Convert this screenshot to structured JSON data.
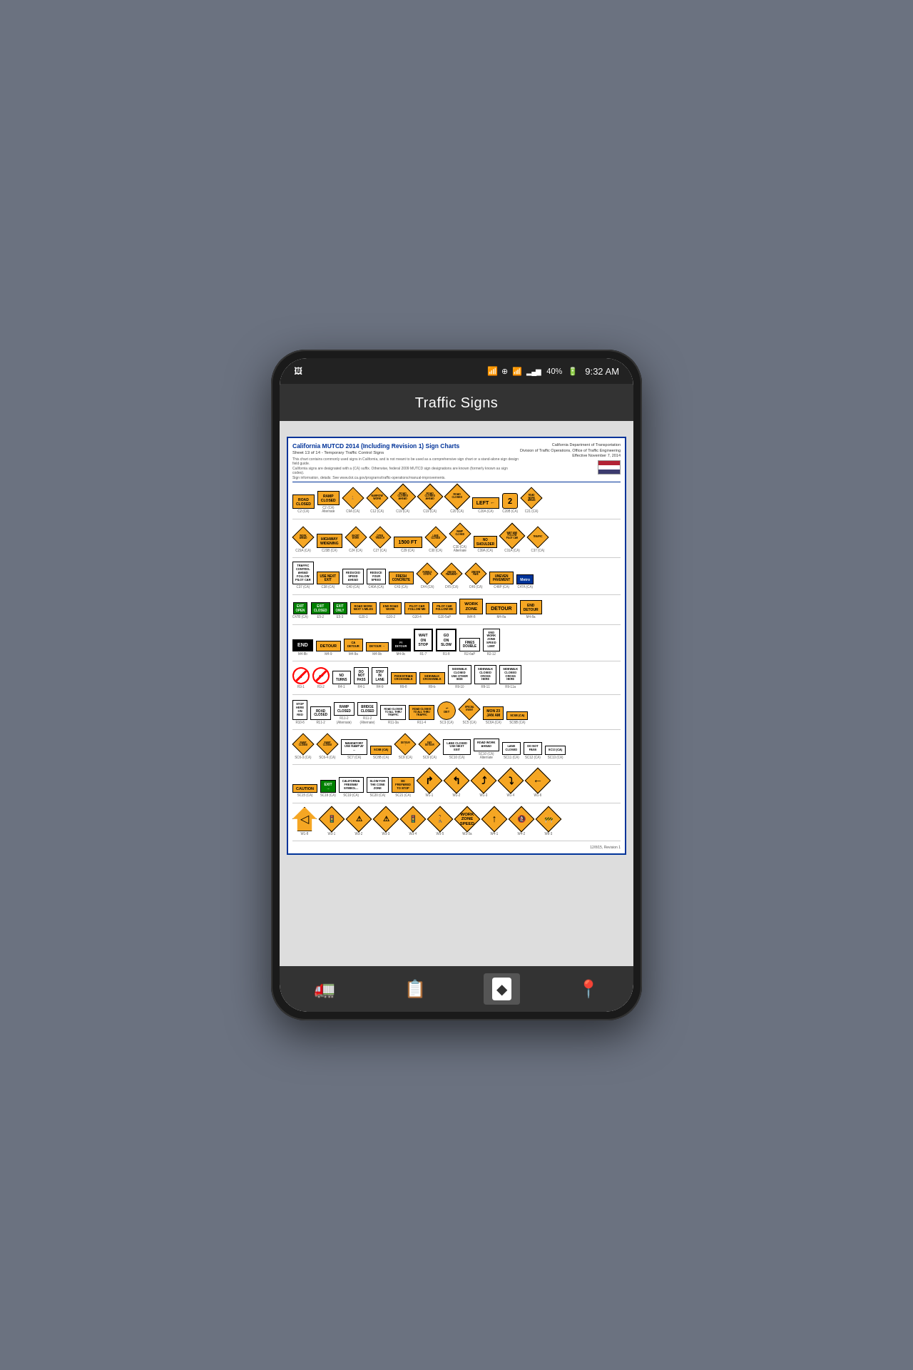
{
  "device": {
    "status_bar": {
      "time": "9:32 AM",
      "battery": "40%",
      "signal": "4 bars",
      "wifi": "on",
      "bluetooth": "on",
      "mute": "on"
    },
    "app_title": "Traffic Signs",
    "bottom_nav": [
      {
        "icon": "truck-icon",
        "label": "Vehicles",
        "active": false
      },
      {
        "icon": "signs-icon",
        "label": "Signs",
        "active": false
      },
      {
        "icon": "navigate-icon",
        "label": "Navigate",
        "active": true
      },
      {
        "icon": "location-icon",
        "label": "Location",
        "active": false
      }
    ]
  },
  "chart": {
    "title": "California MUTCD 2014 (Including Revision 1) Sign Charts",
    "subtitle": "Sheet 13 of 14 - Temporary Traffic Control Signs",
    "agency": "California Department of Transportation",
    "division": "Division of Traffic Operations, Office of Traffic Engineering",
    "effective": "Effective November 7, 2014",
    "footer": "12/8/15, Revision 1",
    "detected_signs": {
      "road_closed": "ROAD CLOSED",
      "ahead": "AheAd"
    }
  }
}
